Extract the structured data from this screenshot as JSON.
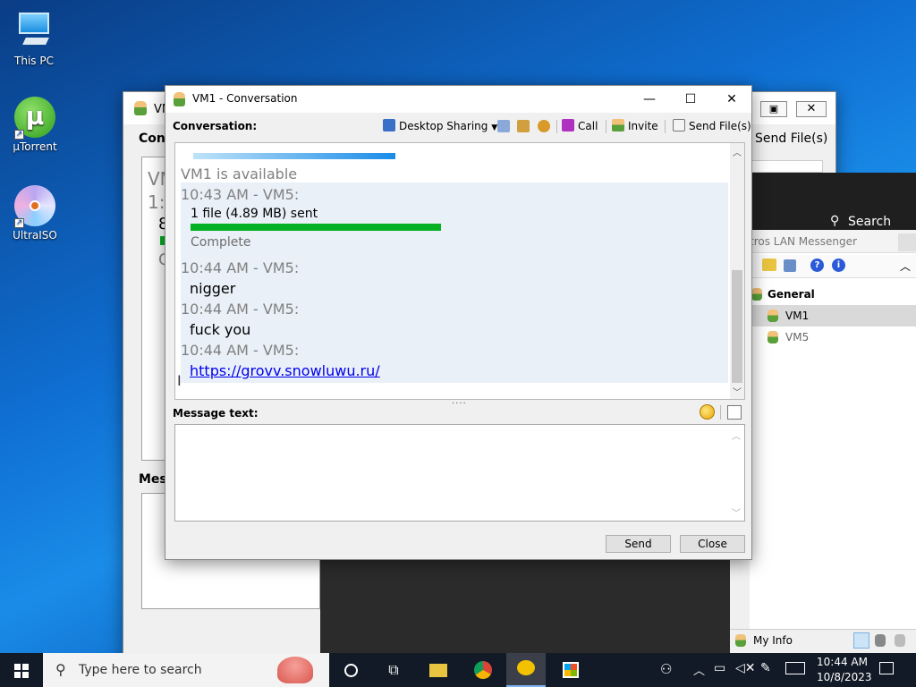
{
  "desktop": {
    "icons": [
      {
        "label": "This PC"
      },
      {
        "label": "µTorrent"
      },
      {
        "label": "UltraISO"
      }
    ]
  },
  "conversation": {
    "title": "VM1 - Conversation",
    "toolbar": {
      "heading": "Conversation:",
      "desktop_sharing": "Desktop Sharing",
      "call": "Call",
      "invite": "Invite",
      "send_files": "Send File(s)"
    },
    "status_line": "VM1 is available",
    "file_transfer": {
      "header": "10:43 AM - VM5:",
      "text": "1 file (4.89 MB) sent",
      "status": "Complete",
      "progress": 1.0
    },
    "messages": [
      {
        "header": "10:44 AM - VM5:",
        "text": "nigger",
        "is_link": false
      },
      {
        "header": "10:44 AM - VM5:",
        "text": "fuck you",
        "is_link": false
      },
      {
        "header": "10:44 AM - VM5:",
        "text": "https://grovv.snowluwu.ru/",
        "is_link": true
      }
    ],
    "message_label": "Message text:",
    "message_value": "",
    "send": "Send",
    "close": "Close"
  },
  "back_window": {
    "title_fragment": "VM",
    "conv_fragment": "Conv",
    "mess_fragment": "Mess",
    "send_files": "Send File(s)",
    "row1": "VM",
    "row2": "1:",
    "row3": "8",
    "row4": "C"
  },
  "messenger": {
    "title_fragment": "tros LAN Messenger",
    "search": "Search",
    "group": "General",
    "users": [
      {
        "name": "VM1",
        "selected": true
      },
      {
        "name": "VM5",
        "selected": false
      }
    ],
    "my_info": "My Info"
  },
  "taskbar": {
    "search_placeholder": "Type here to search",
    "time": "10:44 AM",
    "date": "10/8/2023"
  },
  "colors": {
    "accent": "#0078d7",
    "progress": "#06b025",
    "link": "#0000ee"
  }
}
